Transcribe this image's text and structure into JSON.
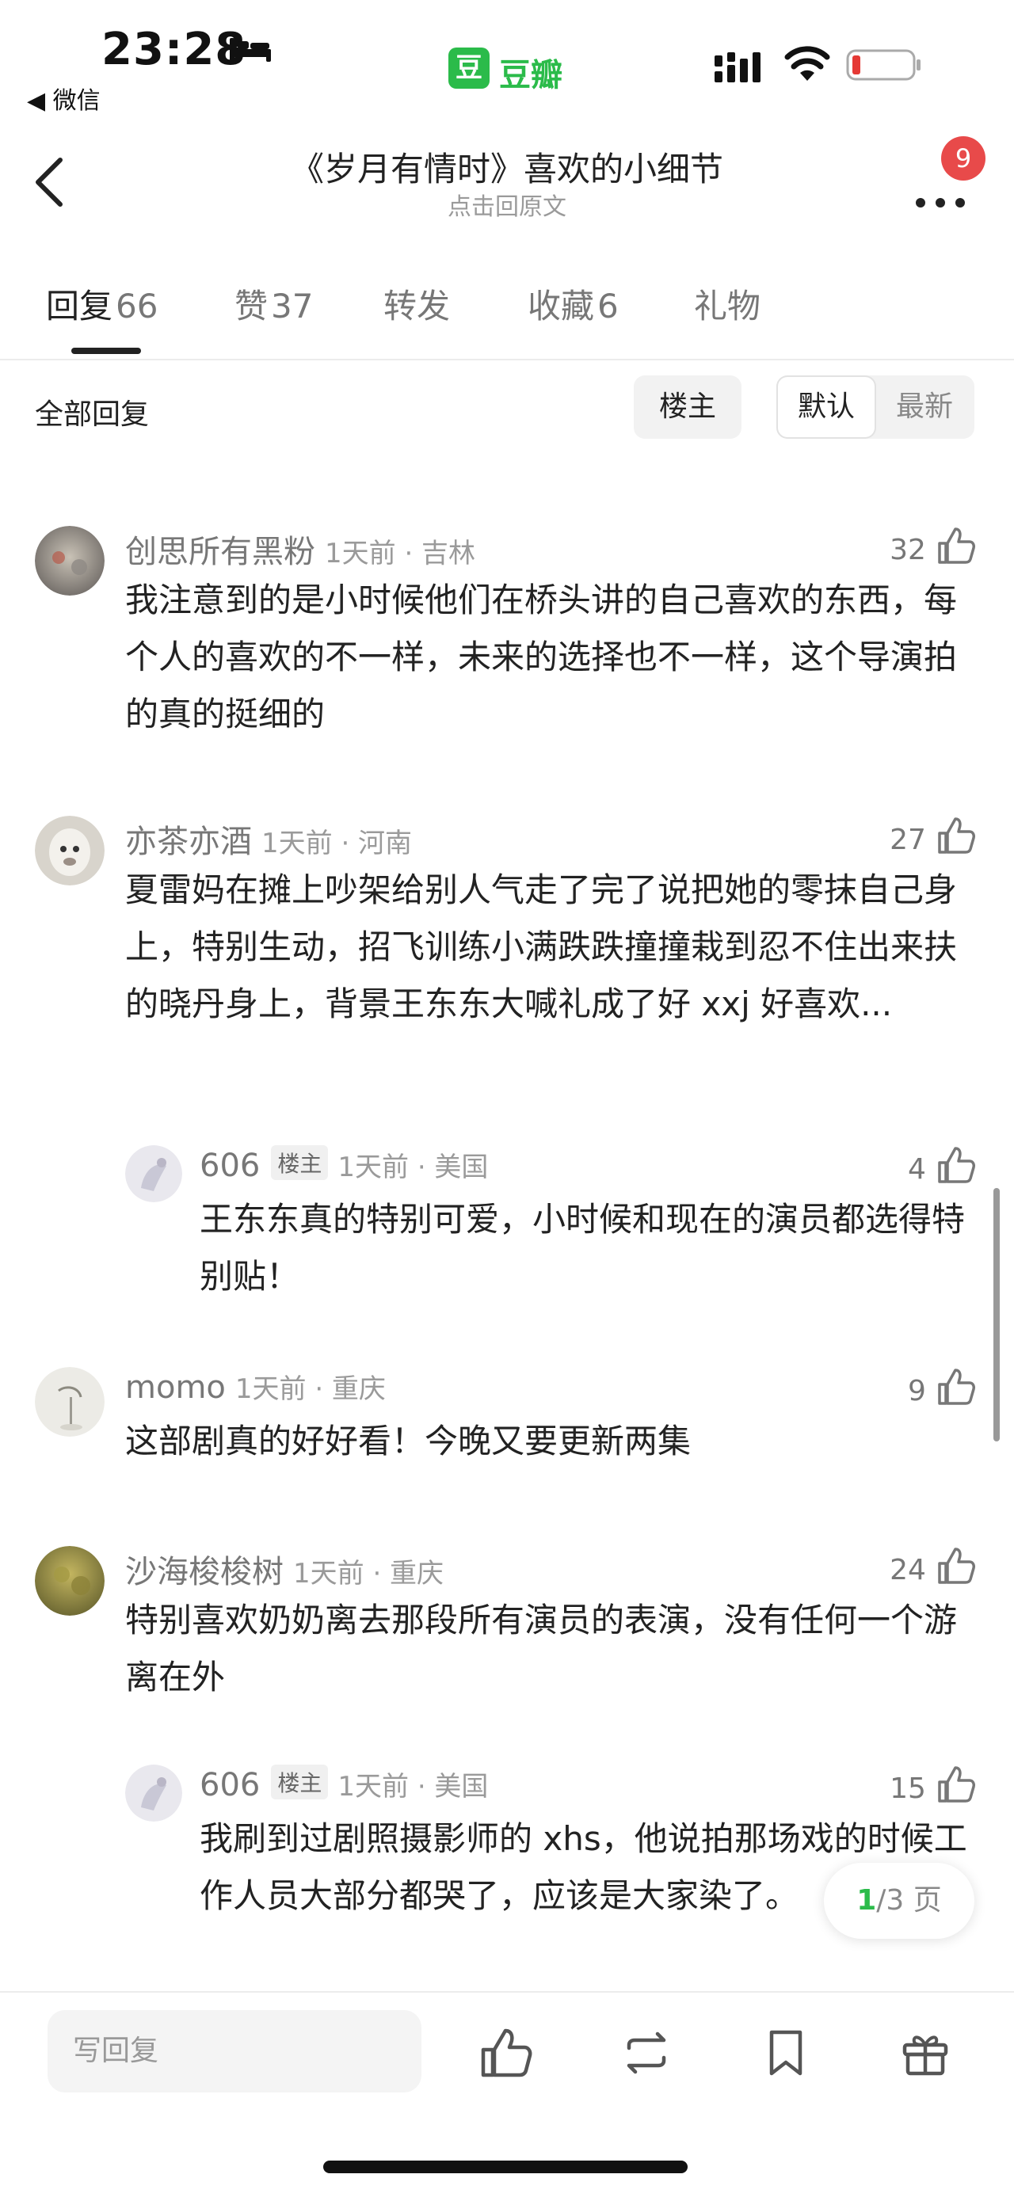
{
  "status_bar": {
    "time": "23:28",
    "back_to_app": "◀ 微信",
    "app_logo_char": "豆",
    "app_name": "豆瓣"
  },
  "nav": {
    "title": "《岁月有情时》喜欢的小细节",
    "subtitle": "点击回原文",
    "notification_count": "9"
  },
  "tabs": [
    {
      "label": "回复",
      "count": "66",
      "active": true
    },
    {
      "label": "赞",
      "count": "37",
      "active": false
    },
    {
      "label": "转发",
      "count": "",
      "active": false
    },
    {
      "label": "收藏",
      "count": "6",
      "active": false
    },
    {
      "label": "礼物",
      "count": "",
      "active": false
    }
  ],
  "filter": {
    "all_replies": "全部回复",
    "op_only": "楼主",
    "default": "默认",
    "latest": "最新"
  },
  "comments": [
    {
      "name": "创思所有黑粉",
      "is_op": false,
      "time_loc": "1天前 · 吉林",
      "likes": "32",
      "text": "我注意到的是小时候他们在桥头讲的自己喜欢的东西，每个人的喜欢的不一样，未来的选择也不一样，这个导演拍的真的挺细的"
    },
    {
      "name": "亦茶亦酒",
      "is_op": false,
      "time_loc": "1天前 · 河南",
      "likes": "27",
      "text": "夏雷妈在摊上吵架给别人气走了完了说把她的零抹自己身上，特别生动，招飞训练小满跌跌撞撞栽到忍不住出来扶的晓丹身上，背景王东东大喊礼成了好 xxj 好喜欢..."
    },
    {
      "name": "606",
      "is_op": true,
      "op_tag": "楼主",
      "time_loc": "1天前 · 美国",
      "likes": "4",
      "text": "王东东真的特别可爱，小时候和现在的演员都选得特别贴！"
    },
    {
      "name": "momo",
      "is_op": false,
      "time_loc": "1天前 · 重庆",
      "likes": "9",
      "text": "这部剧真的好好看！今晚又要更新两集"
    },
    {
      "name": "沙海梭梭树",
      "is_op": false,
      "time_loc": "1天前 · 重庆",
      "likes": "24",
      "text": "特别喜欢奶奶离去那段所有演员的表演，没有任何一个游离在外"
    },
    {
      "name": "606",
      "is_op": true,
      "op_tag": "楼主",
      "time_loc": "1天前 · 美国",
      "likes": "15",
      "text": "我刷到过剧照摄影师的 xhs，他说拍那场戏的时候工作人员大部分都哭了，应该是大家染了。"
    }
  ],
  "pagination": {
    "current": "1",
    "rest": "/3 页"
  },
  "bottom_bar": {
    "reply_placeholder": "写回复"
  },
  "colors": {
    "brand_green": "#2bbb4a",
    "badge_red": "#e84a4a"
  }
}
